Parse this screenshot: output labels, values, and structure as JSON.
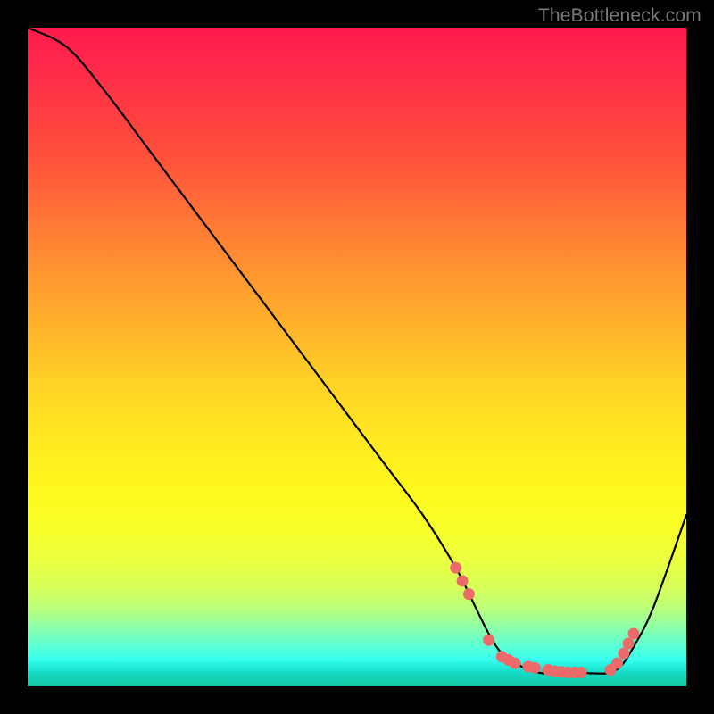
{
  "watermark": "TheBottleneck.com",
  "colors": {
    "background": "#000000",
    "curve_stroke": "#000000",
    "dot_fill": "#ed6a6a",
    "gradient_top": "#ff1a4d",
    "gradient_bottom": "#14c8a0"
  },
  "chart_data": {
    "type": "line",
    "title": "",
    "xlabel": "",
    "ylabel": "",
    "xlim": [
      0,
      100
    ],
    "ylim": [
      0,
      100
    ],
    "x": [
      0,
      6,
      12,
      18,
      24,
      30,
      36,
      42,
      48,
      54,
      60,
      65,
      68,
      70,
      72,
      75,
      78,
      82,
      85,
      88,
      90,
      92,
      95,
      100
    ],
    "y": [
      100,
      97,
      90,
      82,
      74,
      66,
      58,
      50,
      42,
      34,
      26,
      18,
      12,
      8,
      5,
      3,
      2,
      2,
      2,
      2,
      3,
      6,
      12,
      26
    ],
    "dots": {
      "x": [
        65,
        66,
        67,
        70,
        72,
        73,
        74,
        76,
        77,
        79,
        80,
        81,
        82,
        83,
        84,
        88.5,
        89.5,
        90.5,
        91.2,
        92
      ],
      "y": [
        18,
        16,
        14,
        7,
        4.5,
        4,
        3.5,
        3,
        2.8,
        2.5,
        2.3,
        2.2,
        2.1,
        2.1,
        2.1,
        2.5,
        3.5,
        5,
        6.5,
        8
      ]
    }
  }
}
